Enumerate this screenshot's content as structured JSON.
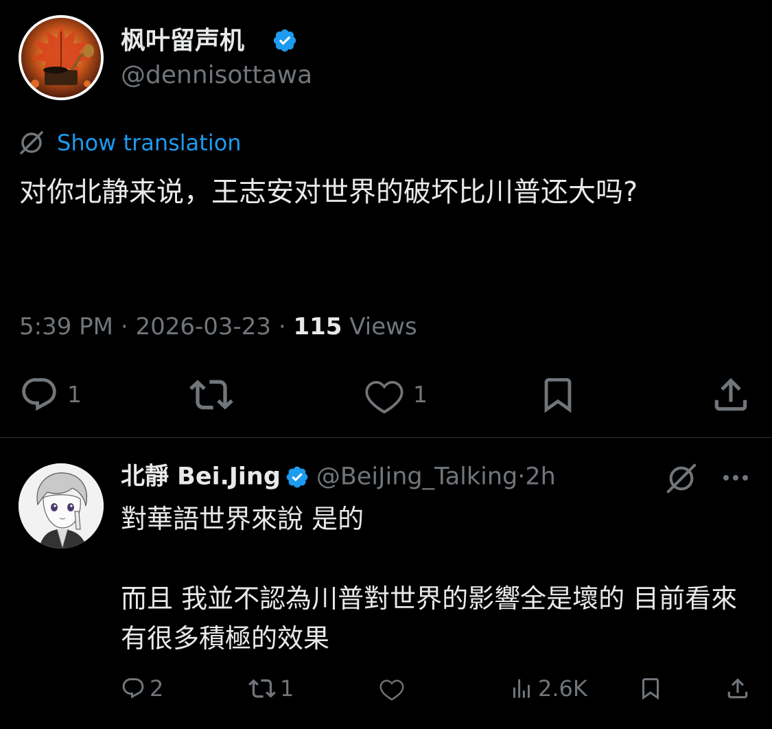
{
  "main_tweet": {
    "display_name": "枫叶留声机",
    "handle": "@dennisottawa",
    "translate_label": "Show translation",
    "text": "对你北静来说，王志安对世界的破坏比川普还大吗?",
    "time": "5:39 PM",
    "separator": "·",
    "date": "2026-03-23",
    "views_count": "115",
    "views_label": "Views",
    "reply_count": "1",
    "like_count": "1"
  },
  "reply_tweet": {
    "display_name": "北靜 Bei.Jing",
    "handle": "@BeiJing_Talking",
    "separator": "·",
    "time_ago": "2h",
    "paragraphs": [
      "對華語世界來說 是的",
      "而且 我並不認為川普對世界的影響全是壞的 目前看來 有很多積極的效果"
    ],
    "reply_count": "2",
    "retweet_count": "1",
    "views_count": "2.6K"
  },
  "colors": {
    "background": "#000000",
    "primary_text": "#e7e9ea",
    "secondary_text": "#71767b",
    "link": "#1d9bf0",
    "verified": "#1d9bf0",
    "divider": "#2f3336"
  }
}
